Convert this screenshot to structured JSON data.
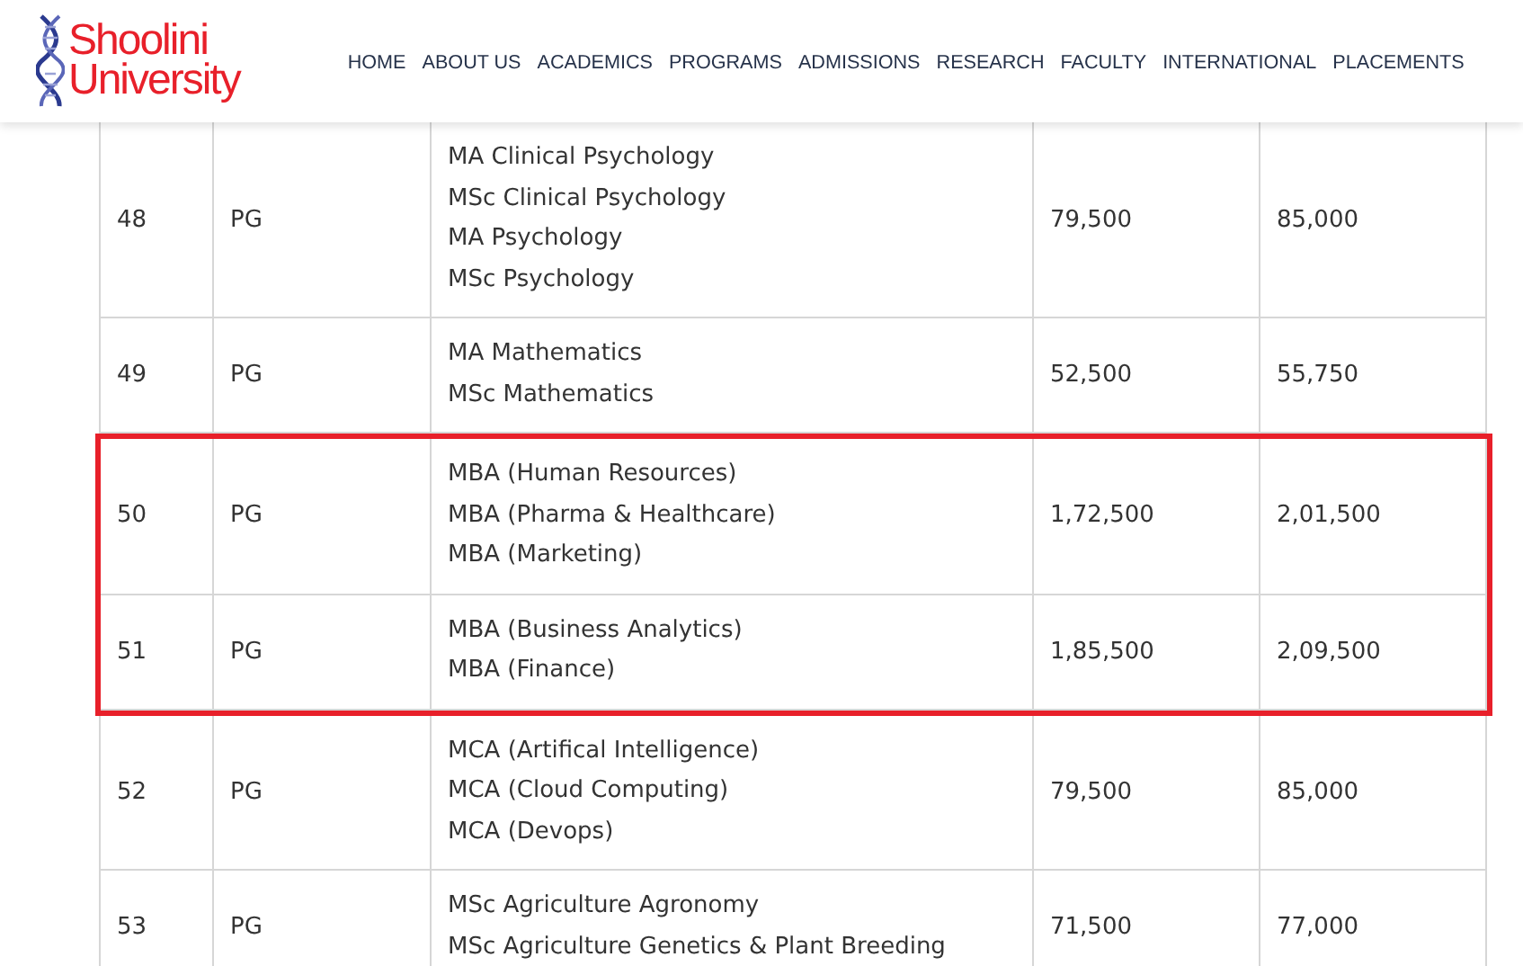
{
  "header": {
    "logo": {
      "line_1": "Shoolini",
      "line_2": "University"
    },
    "nav": [
      {
        "label": "HOME"
      },
      {
        "label": "ABOUT US"
      },
      {
        "label": "ACADEMICS"
      },
      {
        "label": "PROGRAMS"
      },
      {
        "label": "ADMISSIONS"
      },
      {
        "label": "RESEARCH"
      },
      {
        "label": "FACULTY"
      },
      {
        "label": "INTERNATIONAL"
      },
      {
        "label": "PLACEMENTS"
      }
    ]
  },
  "table": {
    "row_groups": [
      {
        "highlighted": false,
        "rows": [
          {
            "number": "48",
            "level": "PG",
            "programs": [
              "MA Clinical Psychology",
              "MSc Clinical Psychology",
              "MA Psychology",
              "MSc Psychology"
            ],
            "column_4": "79,500",
            "column_5": "85,000"
          },
          {
            "number": "49",
            "level": "PG",
            "programs": [
              "MA Mathematics",
              "MSc Mathematics"
            ],
            "column_4": "52,500",
            "column_5": "55,750"
          }
        ]
      },
      {
        "highlighted": true,
        "rows": [
          {
            "number": "50",
            "level": "PG",
            "programs": [
              "MBA (Human Resources)",
              "MBA (Pharma & Healthcare)",
              "MBA (Marketing)"
            ],
            "column_4": "1,72,500",
            "column_5": "2,01,500"
          },
          {
            "number": "51",
            "level": "PG",
            "programs": [
              "MBA (Business Analytics)",
              "MBA (Finance)"
            ],
            "column_4": "1,85,500",
            "column_5": "2,09,500"
          }
        ]
      },
      {
        "highlighted": false,
        "rows": [
          {
            "number": "52",
            "level": "PG",
            "programs": [
              "MCA (Artifical Intelligence)",
              "MCA (Cloud Computing)",
              "MCA (Devops)"
            ],
            "column_4": "79,500",
            "column_5": "85,000"
          },
          {
            "number": "53",
            "level": "PG",
            "programs": [
              "MSc Agriculture Agronomy",
              "MSc Agriculture Genetics & Plant Breeding"
            ],
            "column_4": "71,500",
            "column_5": "77,000"
          }
        ]
      }
    ]
  }
}
